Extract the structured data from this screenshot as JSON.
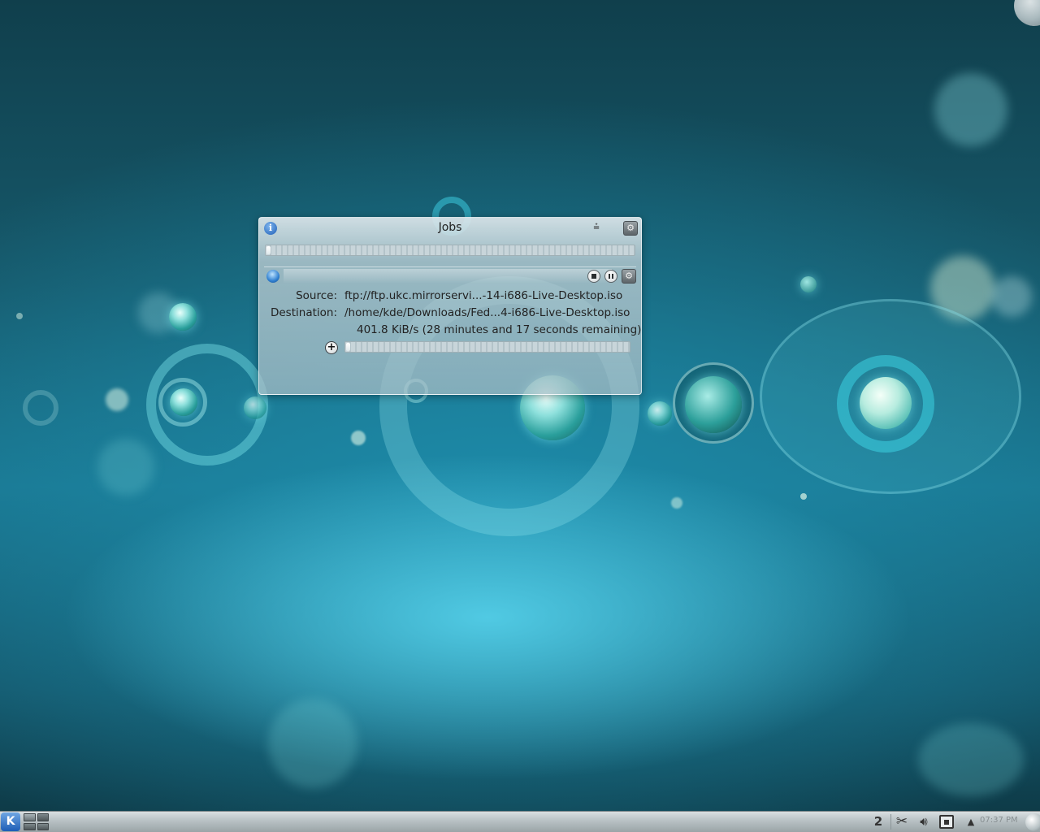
{
  "jobs_window": {
    "title": "Jobs",
    "total_progress_fraction": 0.01,
    "job": {
      "source_label": "Source:",
      "source_value": "ftp://ftp.ukc.mirrorservi...-14-i686-Live-Desktop.iso",
      "destination_label": "Destination:",
      "destination_value": "/home/kde/Downloads/Fed...4-i686-Live-Desktop.iso",
      "speed_text": "401.8 KiB/s (28 minutes and 17 seconds remaining)",
      "progress_fraction": 0.01
    }
  },
  "taskbar": {
    "kde_menu_label": "K",
    "clipboard_label": "2",
    "clock": "07:37 PM"
  },
  "icons": {
    "info": "info-icon",
    "collapse": "collapse-icon",
    "configure": "configure-icon",
    "stop": "stop-icon",
    "pause": "pause-icon",
    "expand": "expand-icon",
    "scissors": "scissors-icon",
    "volume": "volume-icon",
    "network": "network-icon"
  },
  "colors": {
    "wallpaper_dark": "#103f4c",
    "wallpaper_light": "#5ad7f0",
    "accent": "#1d5db6"
  }
}
